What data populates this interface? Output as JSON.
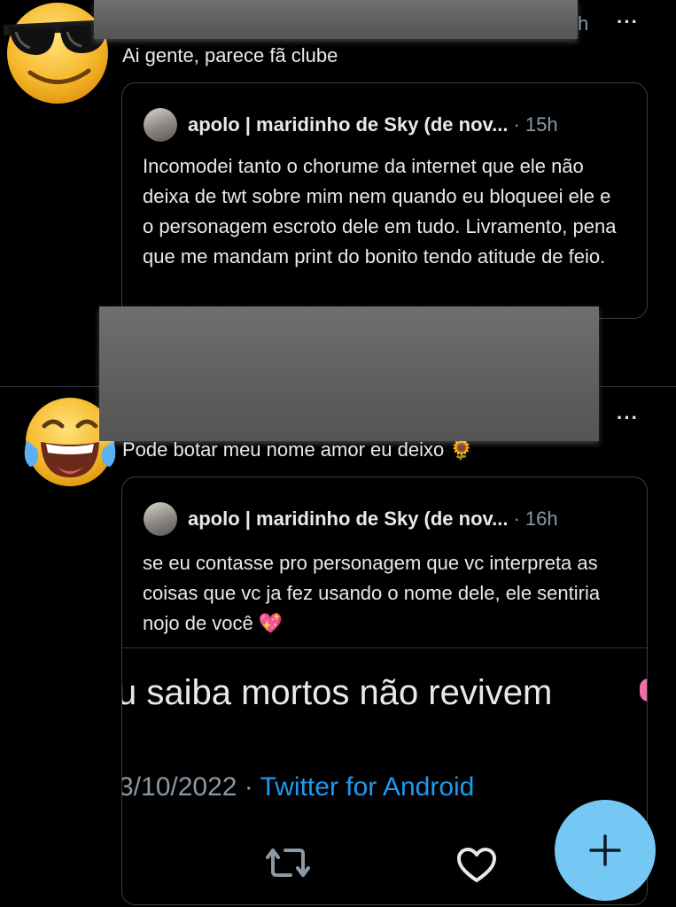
{
  "tweet1": {
    "header_suffix": "h",
    "text": "Ai gente, parece fã clube",
    "quote": {
      "author": "apolo | maridinho de Sky (de nov...",
      "time": "· 15h",
      "text": "Incomodei tanto o chorume da internet que ele não deixa de twt sobre mim nem quando eu bloqueei ele e o personagem escroto dele em tudo. Livramento, pena que me mandam print do bonito tendo atitude de feio."
    }
  },
  "tweet2": {
    "text": "Pode botar meu nome amor eu deixo 🌻",
    "quote": {
      "author": "apolo | maridinho de Sky (de nov...",
      "time": "· 16h",
      "text": "se eu contasse pro personagem que vc interpreta as coisas que vc ja fez usando o nome dele, ele sentiria nojo de você 💖",
      "embedded_text": "u saiba mortos não revivem",
      "date": "3/10/2022 ·",
      "source": "Twitter for Android"
    }
  },
  "icons": {
    "more": "···",
    "retweet": "retweet-icon",
    "like": "heart-icon",
    "compose": "plus-icon"
  },
  "colors": {
    "background": "#000000",
    "text": "#e7e9ea",
    "muted": "#8b98a5",
    "link": "#1d9bf0",
    "fab": "#75c7f4",
    "redaction": "#5e5e5e"
  }
}
